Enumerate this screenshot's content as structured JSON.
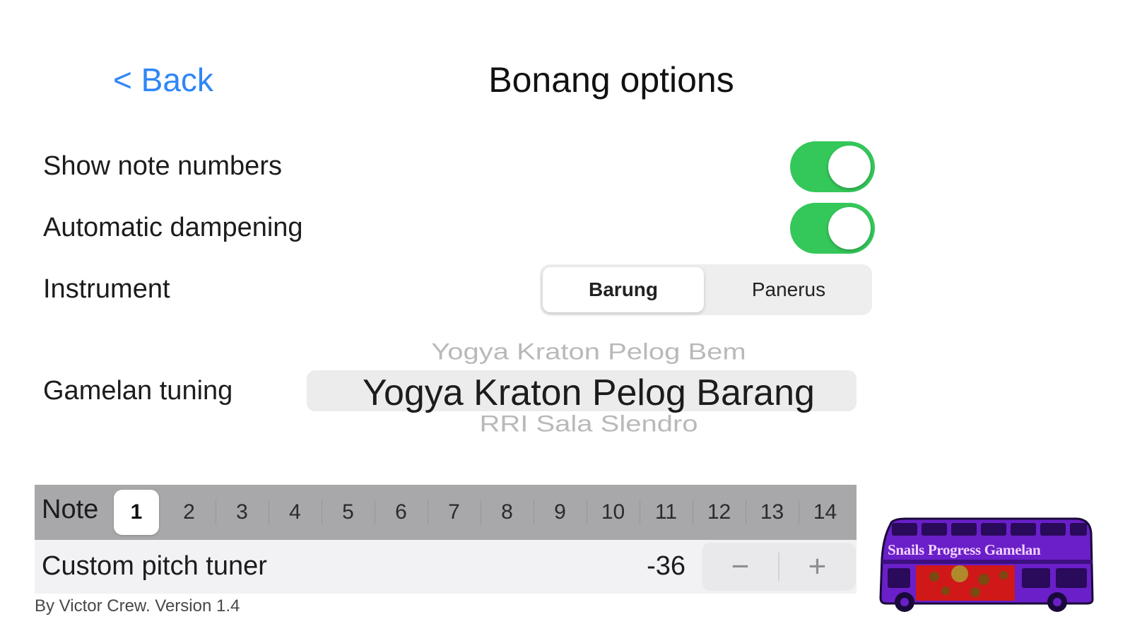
{
  "header": {
    "back_label": "< Back",
    "title": "Bonang options"
  },
  "settings": {
    "show_note_numbers": {
      "label": "Show note numbers",
      "on": true
    },
    "automatic_dampening": {
      "label": "Automatic dampening",
      "on": true
    },
    "instrument": {
      "label": "Instrument",
      "options": [
        "Barung",
        "Panerus"
      ],
      "selected": "Barung"
    },
    "gamelan_tuning": {
      "label": "Gamelan tuning",
      "previous_option": "Yogya Kraton Pelog Bem",
      "selected_option": "Yogya Kraton Pelog Barang",
      "next_option": "RRI Sala Slendro"
    }
  },
  "notes": {
    "label": "Note",
    "items": [
      "1",
      "2",
      "3",
      "4",
      "5",
      "6",
      "7",
      "8",
      "9",
      "10",
      "11",
      "12",
      "13",
      "14"
    ],
    "selected": "1"
  },
  "tuner": {
    "label": "Custom pitch tuner",
    "value": "-36",
    "minus_symbol": "−",
    "plus_symbol": "+"
  },
  "footer": {
    "credit": "By Victor Crew. Version 1.4"
  },
  "logo": {
    "text": "Snails Progress Gamelan",
    "icon": "double-decker-bus-icon"
  },
  "colors": {
    "accent": "#2f86f6",
    "toggle_on": "#34c759",
    "note_bar": "#a8a8aa",
    "logo_purple": "#6a1fc9",
    "logo_red": "#d01818"
  }
}
